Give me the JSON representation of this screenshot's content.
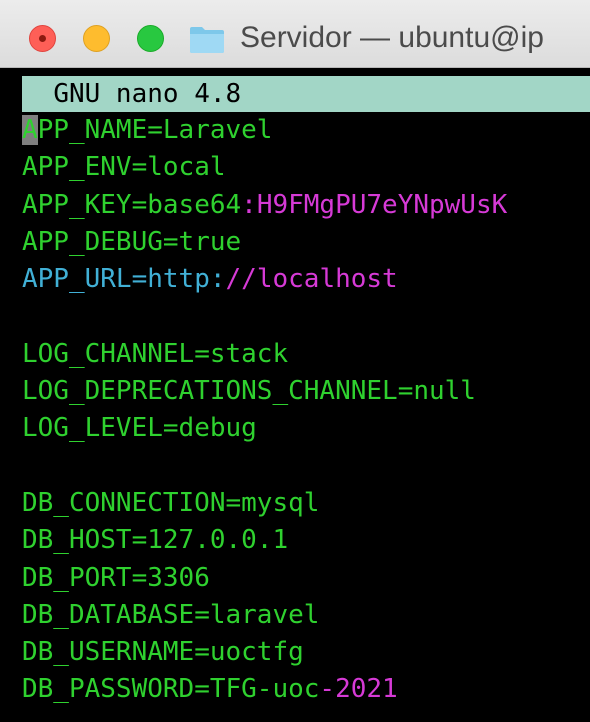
{
  "window": {
    "title": "Servidor — ubuntu@ip"
  },
  "editor": {
    "header": "GNU nano 4.8"
  },
  "lines": [
    {
      "key": "APP_NAME",
      "sep": "=",
      "value": "Laravel"
    },
    {
      "key": "APP_ENV",
      "sep": "=",
      "value": "local"
    },
    {
      "key": "APP_KEY",
      "sep": "=",
      "value": "base64",
      "value_sep": ":",
      "value_rest": "H9FMgPU7eYNpwUsK"
    },
    {
      "key": "APP_DEBUG",
      "sep": "=",
      "value": "true"
    },
    {
      "key": "APP_URL",
      "sep": "=",
      "value": "http:",
      "value_sep": "//",
      "value_rest": "localhost"
    },
    {
      "blank": true
    },
    {
      "key": "LOG_CHANNEL",
      "sep": "=",
      "value": "stack"
    },
    {
      "key": "LOG_DEPRECATIONS_CHANNEL",
      "sep": "=",
      "value": "null"
    },
    {
      "key": "LOG_LEVEL",
      "sep": "=",
      "value": "debug"
    },
    {
      "blank": true
    },
    {
      "key": "DB_CONNECTION",
      "sep": "=",
      "value": "mysql"
    },
    {
      "key": "DB_HOST",
      "sep": "=",
      "value": "127.0.0.1"
    },
    {
      "key": "DB_PORT",
      "sep": "=",
      "value": "3306"
    },
    {
      "key": "DB_DATABASE",
      "sep": "=",
      "value": "laravel"
    },
    {
      "key": "DB_USERNAME",
      "sep": "=",
      "value": "uoctfg"
    },
    {
      "key": "DB_PASSWORD",
      "sep": "=",
      "value": "TFG-uoc",
      "value_sep": "-",
      "value_rest": "2021"
    }
  ],
  "colors": {
    "text_green": "#2fd12f",
    "highlight_magenta": "#d63ad6",
    "url_cyan": "#41b0d6",
    "header_bg": "#a2d6c6",
    "cursor_bg": "#7f7f7f",
    "close_red": "#fe5f57",
    "minimize_yellow": "#febc2e",
    "zoom_green": "#28c840"
  },
  "icons": {
    "window_icon": "folder-icon"
  }
}
